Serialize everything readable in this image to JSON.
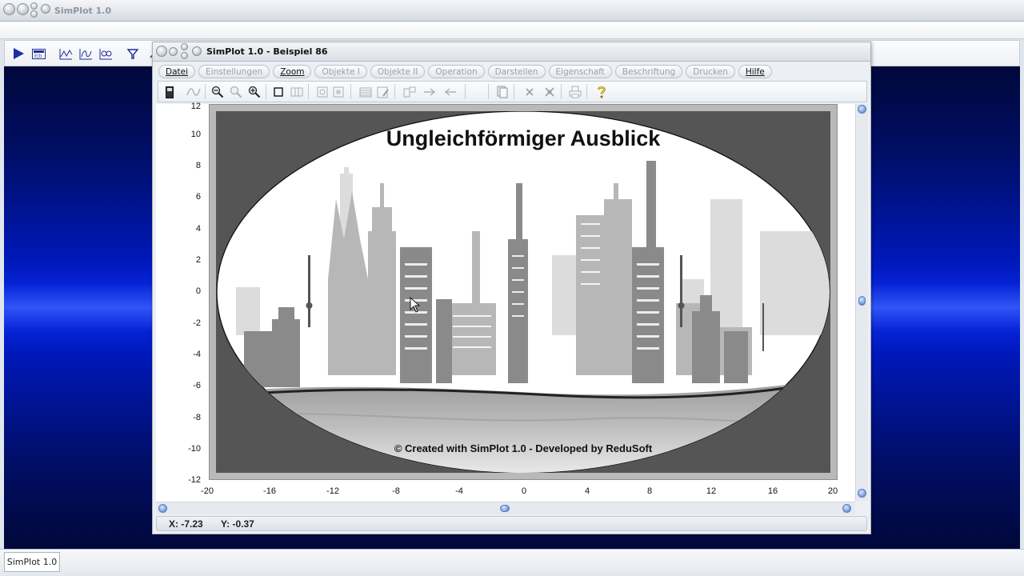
{
  "main_window": {
    "title": "SimPlot 1.0",
    "toolbar_icons": [
      "play-icon",
      "calc-icon",
      "line-graph-icon",
      "param-graph-icon",
      "table-graph-icon",
      "function-icon"
    ]
  },
  "taskbar": {
    "item_label": "SimPlot 1.0"
  },
  "child_window": {
    "title": "SimPlot 1.0 - Beispiel 86",
    "menu": [
      {
        "label": "Datei",
        "enabled": true
      },
      {
        "label": "Einstellungen",
        "enabled": false
      },
      {
        "label": "Zoom",
        "enabled": true
      },
      {
        "label": "Objekte I",
        "enabled": false
      },
      {
        "label": "Objekte II",
        "enabled": false
      },
      {
        "label": "Operation",
        "enabled": false
      },
      {
        "label": "Darstellen",
        "enabled": false
      },
      {
        "label": "Eigenschaft",
        "enabled": false
      },
      {
        "label": "Beschriftung",
        "enabled": false
      },
      {
        "label": "Drucken",
        "enabled": false
      },
      {
        "label": "Hilfe",
        "enabled": true
      }
    ]
  },
  "plot": {
    "title": "Ungleichförmiger Ausblick",
    "credit": "© Created with SimPlot 1.0 - Developed by ReduSoft",
    "y_ticks": [
      "12",
      "10",
      "8",
      "6",
      "4",
      "2",
      "0",
      "-2",
      "-4",
      "-6",
      "-8",
      "-10",
      "-12"
    ],
    "x_ticks": [
      "-20",
      "-16",
      "-12",
      "-8",
      "-4",
      "0",
      "4",
      "8",
      "12",
      "16",
      "20"
    ]
  },
  "status": {
    "x": "X: -7.23",
    "y": "Y: -0.37"
  }
}
